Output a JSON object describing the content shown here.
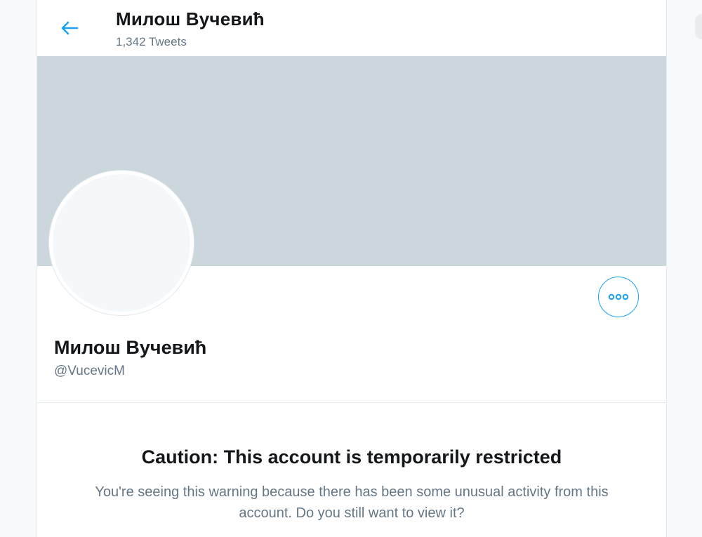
{
  "header": {
    "title": "Милош Вучевић",
    "tweet_count": "1,342 Tweets"
  },
  "profile": {
    "name": "Милош Вучевић",
    "handle": "@VucevicM"
  },
  "warning": {
    "title": "Caution: This account is temporarily restricted",
    "text_line1": "You're seeing this warning because there has been some unusual activity from this",
    "text_line2": "account. Do you still want to view it?"
  },
  "icons": {
    "back": "back-arrow-icon",
    "more": "more-options-icon"
  },
  "colors": {
    "accent": "#1da1f2",
    "banner": "#ccd6dd",
    "text_primary": "#14171a",
    "text_secondary": "#657786"
  }
}
